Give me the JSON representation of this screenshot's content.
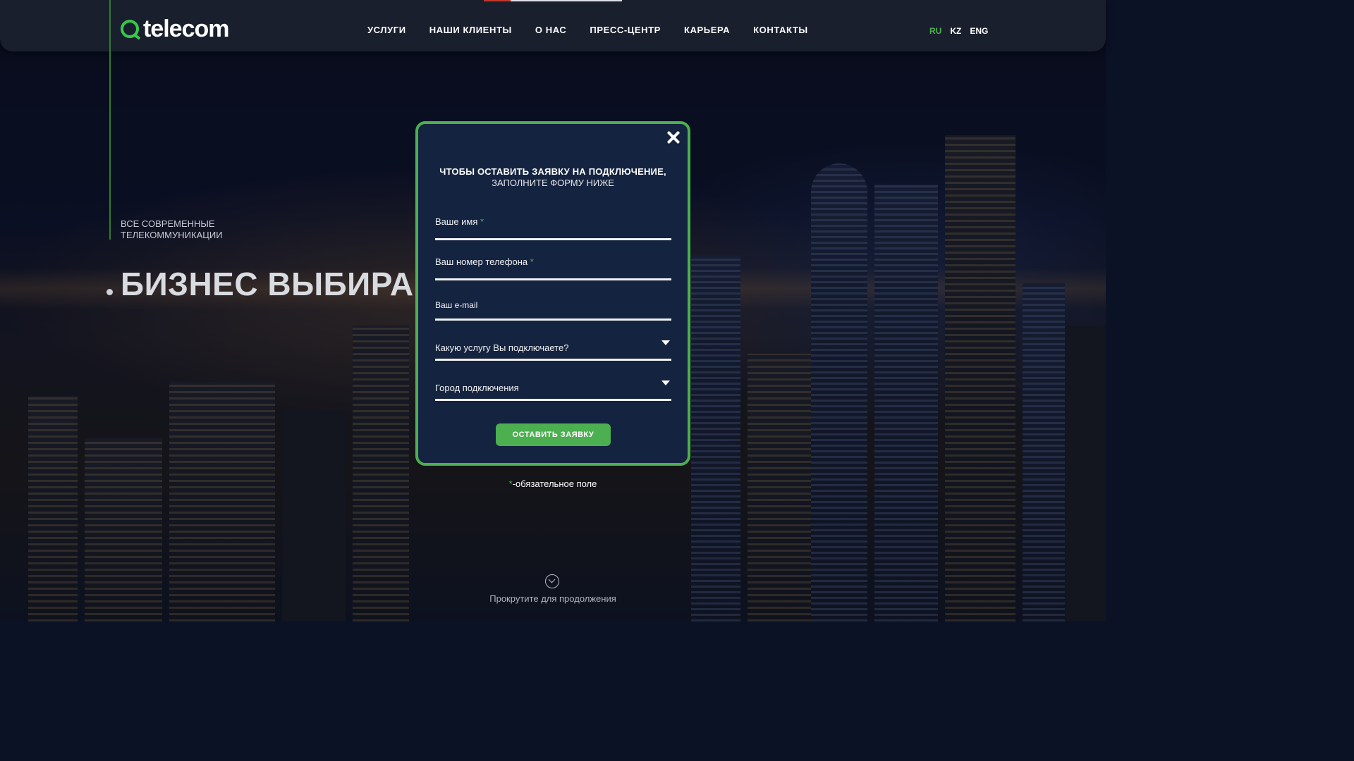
{
  "header": {
    "logo_text": "telecom",
    "nav": [
      "УСЛУГИ",
      "НАШИ КЛИЕНТЫ",
      "О НАС",
      "ПРЕСС-ЦЕНТР",
      "КАРЬЕРА",
      "КОНТАКТЫ"
    ],
    "languages": [
      "RU",
      "KZ",
      "ENG"
    ],
    "active_language": "RU"
  },
  "hero": {
    "subtitle_line1": "ВСЕ СОВРЕМЕННЫЕ",
    "subtitle_line2": "ТЕЛЕКОММУНИКАЦИИ",
    "title": "БИЗНЕС ВЫБИРАЕ"
  },
  "modal": {
    "title": "ЧТОБЫ ОСТАВИТЬ ЗАЯВКУ НА ПОДКЛЮЧЕНИЕ,",
    "subtitle": "ЗАПОЛНИТЕ ФОРМУ НИЖЕ",
    "fields": {
      "name": "Ваше имя",
      "phone": "Ваш номер телефона",
      "email": "Ваш e-mail",
      "service": "Какую услугу Вы подключаете?",
      "city": "Город подключения"
    },
    "required_mark": "*",
    "submit_label": "ОСТАВИТЬ ЗАЯВКУ",
    "required_note": "-обязательное поле"
  },
  "scroll_hint": "Прокрутите для продолжения",
  "colors": {
    "accent": "#4caf50",
    "modal_bg": "#14233f",
    "header_bg": "#1a1f2d"
  }
}
